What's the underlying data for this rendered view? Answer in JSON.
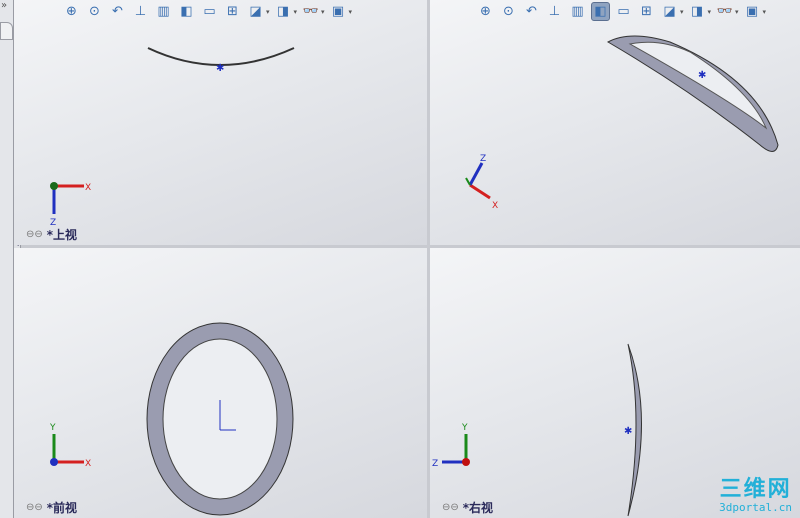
{
  "toolbar": {
    "items": [
      {
        "icon": "zoom-to-fit-icon",
        "glyph": "⊕"
      },
      {
        "icon": "zoom-to-area-icon",
        "glyph": "⊙"
      },
      {
        "icon": "previous-view-icon",
        "glyph": "↶"
      },
      {
        "icon": "section-view-icon",
        "glyph": "⊥"
      },
      {
        "icon": "dynamic-annotation-icon",
        "glyph": "▥"
      },
      {
        "icon": "single-view-icon",
        "glyph": "◧"
      },
      {
        "icon": "two-view-horizontal-icon",
        "glyph": "▭"
      },
      {
        "icon": "four-view-icon",
        "glyph": "⊞"
      },
      {
        "icon": "view-orientation-icon",
        "glyph": "◪",
        "dropdown": true
      },
      {
        "icon": "display-style-icon",
        "glyph": "◨",
        "dropdown": true
      },
      {
        "icon": "hide-show-items-icon",
        "glyph": "👓",
        "dropdown": true
      },
      {
        "icon": "apply-scene-icon",
        "glyph": "▣",
        "dropdown": true
      }
    ]
  },
  "viewports": {
    "top": {
      "label": "*上视"
    },
    "front": {
      "label": "*前视"
    },
    "right": {
      "label": "*右视"
    }
  },
  "axes": {
    "x": "X",
    "y": "Y",
    "z": "Z"
  },
  "watermark": {
    "title": "三维网",
    "url": "3dportal.cn"
  },
  "colors": {
    "x_axis": "#d42020",
    "y_axis": "#1a8a1a",
    "z_axis": "#2030c0",
    "part": "#8a8ca0"
  }
}
